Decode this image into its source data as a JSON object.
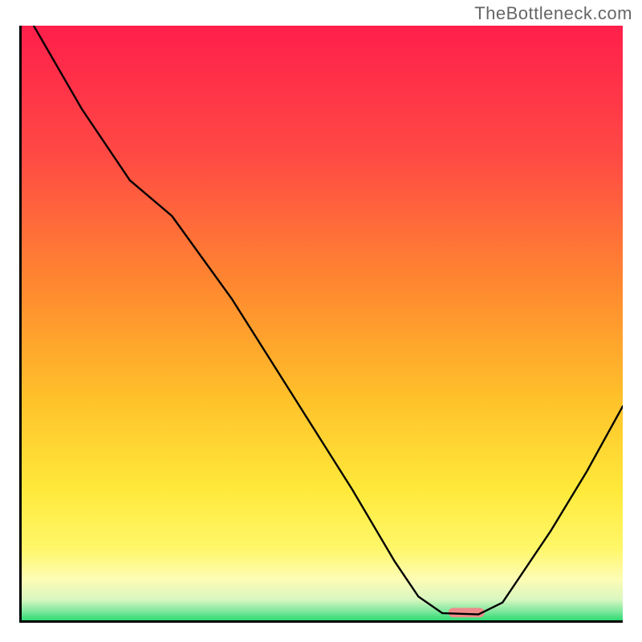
{
  "watermark": "TheBottleneck.com",
  "chart_data": {
    "type": "line",
    "title": "",
    "xlabel": "",
    "ylabel": "",
    "xlim": [
      0,
      100
    ],
    "ylim": [
      0,
      100
    ],
    "grid": false,
    "legend": false,
    "background_gradient_stops": [
      {
        "offset": 0.0,
        "color": "#ff1f4b"
      },
      {
        "offset": 0.22,
        "color": "#ff4a44"
      },
      {
        "offset": 0.45,
        "color": "#ff8c2f"
      },
      {
        "offset": 0.63,
        "color": "#ffc22a"
      },
      {
        "offset": 0.78,
        "color": "#ffe93a"
      },
      {
        "offset": 0.88,
        "color": "#fff76a"
      },
      {
        "offset": 0.93,
        "color": "#fefcb4"
      },
      {
        "offset": 0.965,
        "color": "#d9f7c0"
      },
      {
        "offset": 0.985,
        "color": "#7de89c"
      },
      {
        "offset": 1.0,
        "color": "#2edb72"
      }
    ],
    "series": [
      {
        "name": "bottleneck-curve",
        "color": "#000000",
        "width": 2.4,
        "points": [
          {
            "x": 2,
            "y": 100
          },
          {
            "x": 10,
            "y": 86
          },
          {
            "x": 18,
            "y": 74
          },
          {
            "x": 25,
            "y": 68
          },
          {
            "x": 35,
            "y": 54
          },
          {
            "x": 45,
            "y": 38
          },
          {
            "x": 55,
            "y": 22
          },
          {
            "x": 62,
            "y": 10
          },
          {
            "x": 66,
            "y": 4
          },
          {
            "x": 70,
            "y": 1.2
          },
          {
            "x": 76,
            "y": 1.0
          },
          {
            "x": 80,
            "y": 3
          },
          {
            "x": 88,
            "y": 15
          },
          {
            "x": 94,
            "y": 25
          },
          {
            "x": 100,
            "y": 36
          }
        ]
      }
    ],
    "marker": {
      "name": "optimal-indicator",
      "color": "#ef8a8a",
      "x_start": 71,
      "x_end": 77,
      "y": 0.5,
      "height": 1.6
    }
  }
}
